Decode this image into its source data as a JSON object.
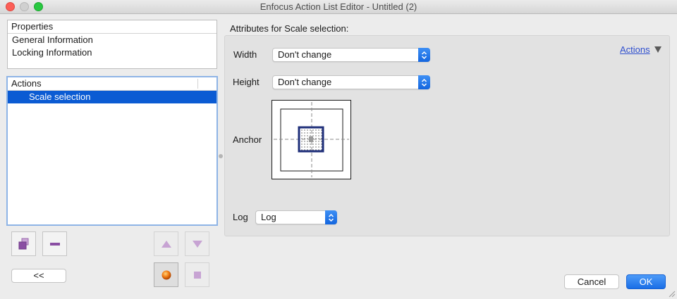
{
  "window": {
    "title": "Enfocus Action List Editor - Untitled (2)"
  },
  "properties": {
    "header": "Properties",
    "items": [
      "General Information",
      "Locking Information"
    ]
  },
  "actions_list": {
    "header": "Actions",
    "items": [
      "Scale selection"
    ],
    "selected_index": 0
  },
  "toolbar": {
    "duplicate_icon": "duplicate-icon",
    "remove_icon": "minus-icon",
    "move_up_icon": "triangle-up-icon",
    "move_down_icon": "triangle-down-icon",
    "run_icon": "orange-ball-icon",
    "stop_icon": "square-icon",
    "collapse_label": "<<"
  },
  "attributes": {
    "title": "Attributes for Scale selection:",
    "width_label": "Width",
    "width_value": "Don't change",
    "height_label": "Height",
    "height_value": "Don't change",
    "anchor_label": "Anchor",
    "log_label": "Log",
    "log_value": "Log",
    "actions_link": "Actions"
  },
  "buttons": {
    "cancel": "Cancel",
    "ok": "OK"
  },
  "colors": {
    "selection": "#0b5bd3",
    "accent": "#1a6ee6",
    "link": "#2f4fcf",
    "anchor_frame": "#1f2f7a",
    "run_orange": "#f07a12"
  }
}
